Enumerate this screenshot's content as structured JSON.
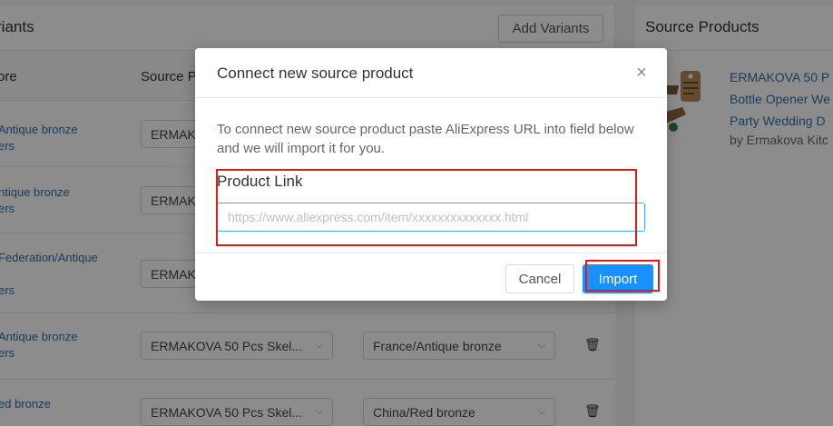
{
  "background": {
    "variants_title": "riants",
    "add_variants_label": "Add Variants",
    "col_store": "ore",
    "col_source": "Source P",
    "rows": [
      {
        "store_line1": "Antique bronze",
        "store_line2": "ers",
        "source_value": "ERMAK",
        "option_value": "",
        "show_trash": false
      },
      {
        "store_line1": "ntique bronze",
        "store_line2": "ers",
        "source_value": "ERMAK",
        "option_value": "",
        "show_trash": false
      },
      {
        "store_line1": "Federation/Antique",
        "store_line2": "ers",
        "source_value": "ERMAK",
        "option_value": "",
        "show_trash": false
      },
      {
        "store_line1": "Antique bronze",
        "store_line2": "ers",
        "source_value": "ERMAKOVA 50 Pcs Skel...",
        "option_value": "France/Antique bronze",
        "show_trash": true
      },
      {
        "store_line1": "ed bronze",
        "store_line2": "",
        "source_value": "ERMAKOVA 50 Pcs Skel...",
        "option_value": "China/Red bronze",
        "show_trash": true
      }
    ],
    "source_products_title": "Source Products",
    "source_product": {
      "link_line1": "ERMAKOVA 50 P",
      "link_line2": "Bottle Opener We",
      "link_line3": "Party Wedding D",
      "by_line": "by Ermakova Kitc"
    }
  },
  "modal": {
    "title": "Connect new source product",
    "close_glyph": "×",
    "description": "To connect new source product paste AliExpress URL into field below and we will import it for you.",
    "field_label": "Product Link",
    "input_value": "",
    "input_placeholder": "https://www.aliexpress.com/item/xxxxxxxxxxxxxx.html",
    "cancel_label": "Cancel",
    "import_label": "Import"
  },
  "colors": {
    "primary": "#1890ff",
    "link": "#2e6fa7",
    "annotation": "#e01b1b"
  },
  "icons": {
    "close": "close-icon",
    "trash": "trash-icon",
    "chevron": "chevron-down-icon"
  }
}
